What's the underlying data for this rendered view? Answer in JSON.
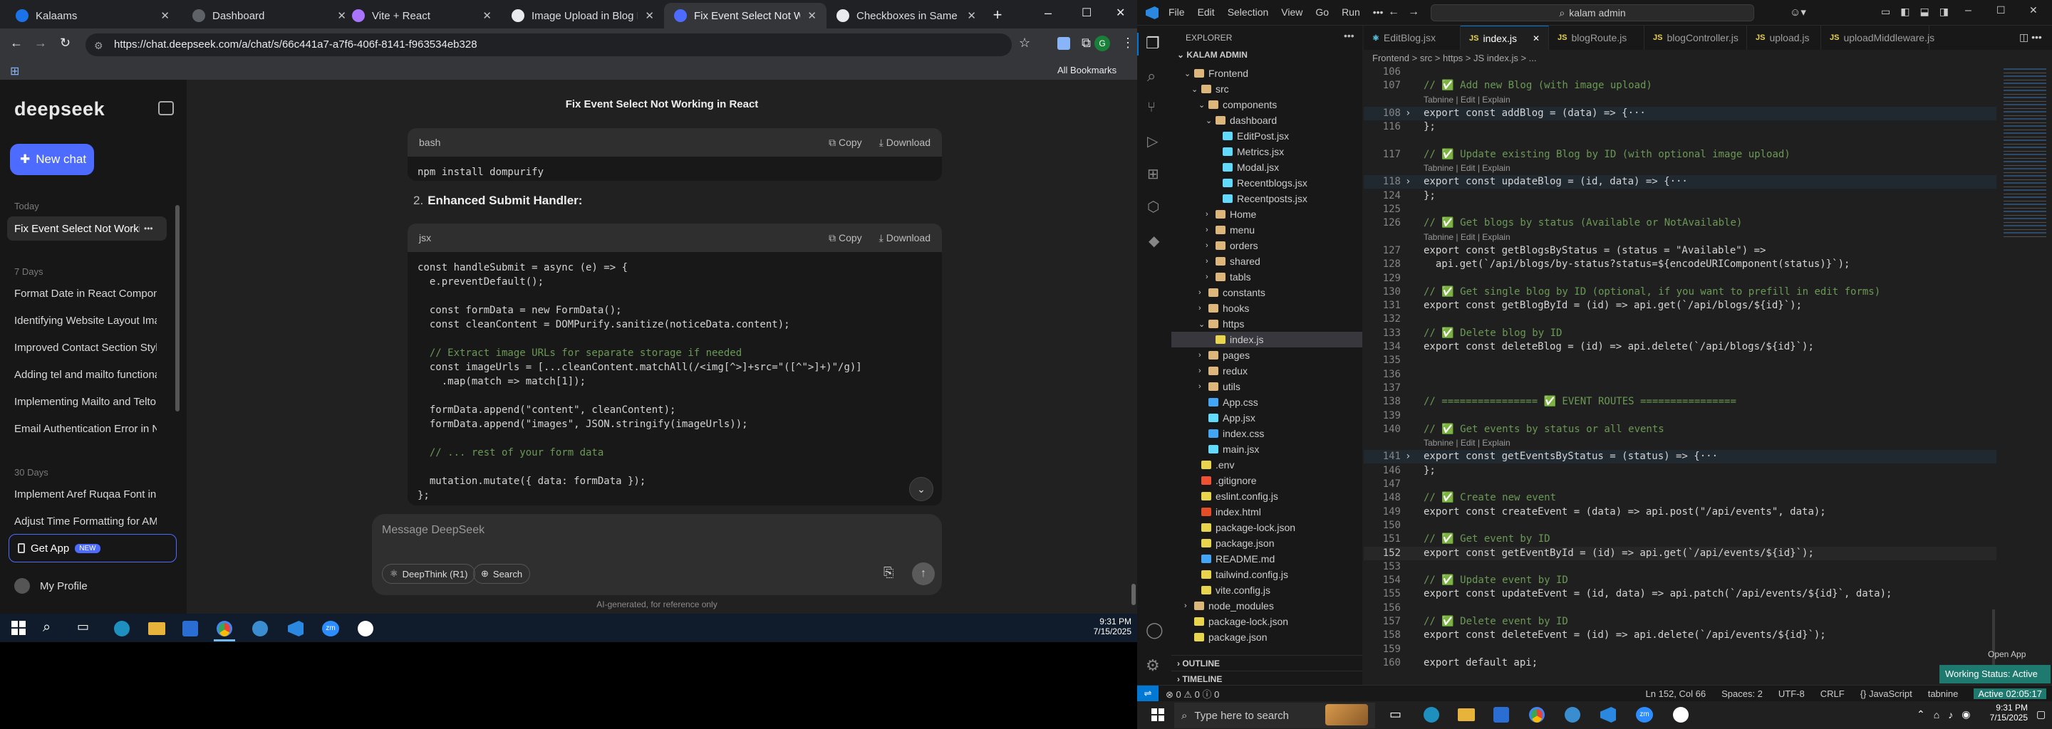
{
  "chrome": {
    "tabs": [
      {
        "title": "Kalaams",
        "fav": "#1a73e8",
        "active": false
      },
      {
        "title": "Dashboard",
        "fav": "#5f6368",
        "active": false
      },
      {
        "title": "Vite + React",
        "fav": "#a974ff",
        "active": false
      },
      {
        "title": "Image Upload in Blog Editor",
        "fav": "#e8eaed",
        "active": false
      },
      {
        "title": "Fix Event Select Not Working",
        "fav": "#4d6bfe",
        "active": true
      },
      {
        "title": "Checkboxes in Same Row",
        "fav": "#e8eaed",
        "active": false
      }
    ],
    "new_tab": "+",
    "url": "https://chat.deepseek.com/a/chat/s/66c441a7-a7f6-406f-8141-f963534eb328",
    "bookmarks_label": "All Bookmarks",
    "win_min": "–",
    "win_max": "☐",
    "win_close": "✕"
  },
  "deepseek": {
    "logo": "deepseek",
    "new_chat": "New chat",
    "today_label": "Today",
    "active_chat": "Fix Event Select Not Working",
    "more": "•••",
    "week_label": "7 Days",
    "week_items": [
      "Format Date in React Component",
      "Identifying Website Layout Image",
      "Improved Contact Section Styling",
      "Adding tel and mailto functional",
      "Implementing Mailto and Telto F",
      "Email Authentication Error in No"
    ],
    "month_label": "30 Days",
    "month_items": [
      "Implement Aref Ruqaa Font in R",
      "Adjust Time Formatting for AM/P"
    ],
    "get_app": "Get App",
    "new_badge": "NEW",
    "profile": "My Profile",
    "chat_title": "Fix Event Select Not Working in React",
    "block1_lang": "bash",
    "copy": "Copy",
    "download": "Download",
    "block1_code": "npm install dompurify",
    "step_num": "2.",
    "step_title": "Enhanced Submit Handler:",
    "block2_lang": "jsx",
    "block2_lines": [
      "const handleSubmit = async (e) => {",
      "  e.preventDefault();",
      "",
      "  const formData = new FormData();",
      "  const cleanContent = DOMPurify.sanitize(noticeData.content);",
      "",
      "  // Extract image URLs for separate storage if needed",
      "  const imageUrls = [...cleanContent.matchAll(/<img[^>]+src=\"([^\">]+)\"/g)]",
      "    .map(match => match[1]);",
      "",
      "  formData.append(\"content\", cleanContent);",
      "  formData.append(\"images\", JSON.stringify(imageUrls));",
      "",
      "  // ... rest of your form data",
      "",
      "  mutation.mutate({ data: formData });",
      "};"
    ],
    "input_placeholder": "Message DeepSeek",
    "deepthink": "DeepThink (R1)",
    "search": "Search",
    "footer": "AI-generated, for reference only"
  },
  "taskbar_left": {
    "time": "9:31 PM",
    "date": "7/15/2025"
  },
  "vscode": {
    "menu": [
      "File",
      "Edit",
      "Selection",
      "View",
      "Go",
      "Run",
      "•••"
    ],
    "search": "kalam admin",
    "explorer_title": "EXPLORER",
    "root": "KALAM ADMIN",
    "tree": [
      {
        "d": 1,
        "label": "Frontend",
        "kind": "open"
      },
      {
        "d": 2,
        "label": "src",
        "kind": "open"
      },
      {
        "d": 3,
        "label": "components",
        "kind": "open"
      },
      {
        "d": 4,
        "label": "dashboard",
        "kind": "open"
      },
      {
        "d": 5,
        "label": "EditPost.jsx",
        "kind": "jsx"
      },
      {
        "d": 5,
        "label": "Metrics.jsx",
        "kind": "jsx"
      },
      {
        "d": 5,
        "label": "Modal.jsx",
        "kind": "jsx"
      },
      {
        "d": 5,
        "label": "Recentblogs.jsx",
        "kind": "jsx"
      },
      {
        "d": 5,
        "label": "Recentposts.jsx",
        "kind": "jsx"
      },
      {
        "d": 4,
        "label": "Home",
        "kind": "closed"
      },
      {
        "d": 4,
        "label": "menu",
        "kind": "closed"
      },
      {
        "d": 4,
        "label": "orders",
        "kind": "closed"
      },
      {
        "d": 4,
        "label": "shared",
        "kind": "closed"
      },
      {
        "d": 4,
        "label": "tabls",
        "kind": "closed"
      },
      {
        "d": 3,
        "label": "constants",
        "kind": "closed"
      },
      {
        "d": 3,
        "label": "hooks",
        "kind": "closed"
      },
      {
        "d": 3,
        "label": "https",
        "kind": "open"
      },
      {
        "d": 4,
        "label": "index.js",
        "kind": "js",
        "sel": true
      },
      {
        "d": 3,
        "label": "pages",
        "kind": "closed"
      },
      {
        "d": 3,
        "label": "redux",
        "kind": "closed"
      },
      {
        "d": 3,
        "label": "utils",
        "kind": "closed"
      },
      {
        "d": 3,
        "label": "App.css",
        "kind": "css"
      },
      {
        "d": 3,
        "label": "App.jsx",
        "kind": "jsx"
      },
      {
        "d": 3,
        "label": "index.css",
        "kind": "css"
      },
      {
        "d": 3,
        "label": "main.jsx",
        "kind": "jsx"
      },
      {
        "d": 2,
        "label": ".env",
        "kind": "env"
      },
      {
        "d": 2,
        "label": ".gitignore",
        "kind": "git"
      },
      {
        "d": 2,
        "label": "eslint.config.js",
        "kind": "js"
      },
      {
        "d": 2,
        "label": "index.html",
        "kind": "html"
      },
      {
        "d": 2,
        "label": "package-lock.json",
        "kind": "json"
      },
      {
        "d": 2,
        "label": "package.json",
        "kind": "json"
      },
      {
        "d": 2,
        "label": "README.md",
        "kind": "md"
      },
      {
        "d": 2,
        "label": "tailwind.config.js",
        "kind": "js"
      },
      {
        "d": 2,
        "label": "vite.config.js",
        "kind": "js"
      },
      {
        "d": 1,
        "label": "node_modules",
        "kind": "closed"
      },
      {
        "d": 1,
        "label": "package-lock.json",
        "kind": "json"
      },
      {
        "d": 1,
        "label": "package.json",
        "kind": "json"
      }
    ],
    "outline": "OUTLINE",
    "timeline": "TIMELINE",
    "tabs": [
      "EditBlog.jsx",
      "index.js",
      "blogRoute.js",
      "blogController.js",
      "upload.js",
      "uploadMiddleware.js"
    ],
    "active_tab": 1,
    "breadcrumb": "Frontend > src > https > JS index.js > ...",
    "lines": [
      {
        "n": "106",
        "t": "",
        "k": "code"
      },
      {
        "n": "107",
        "t": "// ✅ Add new Blog (with image upload)",
        "k": "comment"
      },
      {
        "n": "",
        "t": "Tabnine | Edit | Explain",
        "k": "lens"
      },
      {
        "n": "108",
        "t": "export const addBlog = (data) => {···",
        "k": "fold"
      },
      {
        "n": "116",
        "t": "};",
        "k": "code"
      },
      {
        "n": "",
        "t": "",
        "k": "code"
      },
      {
        "n": "117",
        "t": "// ✅ Update existing Blog by ID (with optional image upload)",
        "k": "comment"
      },
      {
        "n": "",
        "t": "Tabnine | Edit | Explain",
        "k": "lens"
      },
      {
        "n": "118",
        "t": "export const updateBlog = (id, data) => {···",
        "k": "fold"
      },
      {
        "n": "124",
        "t": "};",
        "k": "code"
      },
      {
        "n": "125",
        "t": "",
        "k": "code"
      },
      {
        "n": "126",
        "t": "// ✅ Get blogs by status (Available or NotAvailable)",
        "k": "comment"
      },
      {
        "n": "",
        "t": "Tabnine | Edit | Explain",
        "k": "lens"
      },
      {
        "n": "127",
        "t": "export const getBlogsByStatus = (status = \"Available\") =>",
        "k": "code"
      },
      {
        "n": "128",
        "t": "  api.get(`/api/blogs/by-status?status=${encodeURIComponent(status)}`);",
        "k": "code"
      },
      {
        "n": "129",
        "t": "",
        "k": "code"
      },
      {
        "n": "130",
        "t": "// ✅ Get single blog by ID (optional, if you want to prefill in edit forms)",
        "k": "comment"
      },
      {
        "n": "131",
        "t": "export const getBlogById = (id) => api.get(`/api/blogs/${id}`);",
        "k": "code"
      },
      {
        "n": "132",
        "t": "",
        "k": "code"
      },
      {
        "n": "133",
        "t": "// ✅ Delete blog by ID",
        "k": "comment"
      },
      {
        "n": "134",
        "t": "export const deleteBlog = (id) => api.delete(`/api/blogs/${id}`);",
        "k": "code"
      },
      {
        "n": "135",
        "t": "",
        "k": "code"
      },
      {
        "n": "136",
        "t": "",
        "k": "code"
      },
      {
        "n": "137",
        "t": "",
        "k": "code"
      },
      {
        "n": "138",
        "t": "// ================ ✅ EVENT ROUTES ================",
        "k": "comment"
      },
      {
        "n": "139",
        "t": "",
        "k": "code"
      },
      {
        "n": "140",
        "t": "// ✅ Get events by status or all events",
        "k": "comment"
      },
      {
        "n": "",
        "t": "Tabnine | Edit | Explain",
        "k": "lens"
      },
      {
        "n": "141",
        "t": "export const getEventsByStatus = (status) => {···",
        "k": "fold"
      },
      {
        "n": "146",
        "t": "};",
        "k": "code"
      },
      {
        "n": "147",
        "t": "",
        "k": "code"
      },
      {
        "n": "148",
        "t": "// ✅ Create new event",
        "k": "comment"
      },
      {
        "n": "149",
        "t": "export const createEvent = (data) => api.post(\"/api/events\", data);",
        "k": "code"
      },
      {
        "n": "150",
        "t": "",
        "k": "code"
      },
      {
        "n": "151",
        "t": "// ✅ Get event by ID",
        "k": "comment"
      },
      {
        "n": "152",
        "t": "export const getEventById = (id) => api.get(`/api/events/${id}`);",
        "k": "hl"
      },
      {
        "n": "153",
        "t": "",
        "k": "code"
      },
      {
        "n": "154",
        "t": "// ✅ Update event by ID",
        "k": "comment"
      },
      {
        "n": "155",
        "t": "export const updateEvent = (id, data) => api.patch(`/api/events/${id}`, data);",
        "k": "code"
      },
      {
        "n": "156",
        "t": "",
        "k": "code"
      },
      {
        "n": "157",
        "t": "// ✅ Delete event by ID",
        "k": "comment"
      },
      {
        "n": "158",
        "t": "export const deleteEvent = (id) => api.delete(`/api/events/${id}`);",
        "k": "code"
      },
      {
        "n": "159",
        "t": "",
        "k": "code"
      },
      {
        "n": "160",
        "t": "export default api;",
        "k": "code"
      }
    ],
    "open_app": "Open App",
    "working_status": "Working Status: Active",
    "status_left": "⊗ 0 ⚠ 0  ⓘ 0",
    "status_ln": "Ln 152, Col 66",
    "status_spaces": "Spaces: 2",
    "status_enc": "UTF-8",
    "status_eol": "CRLF",
    "status_lang": "{} JavaScript",
    "status_tabnine": "tabnine",
    "status_active": "Active 02:05:17"
  },
  "taskbar_right": {
    "search": "Type here to search",
    "time": "9:31 PM",
    "date": "7/15/2025"
  }
}
